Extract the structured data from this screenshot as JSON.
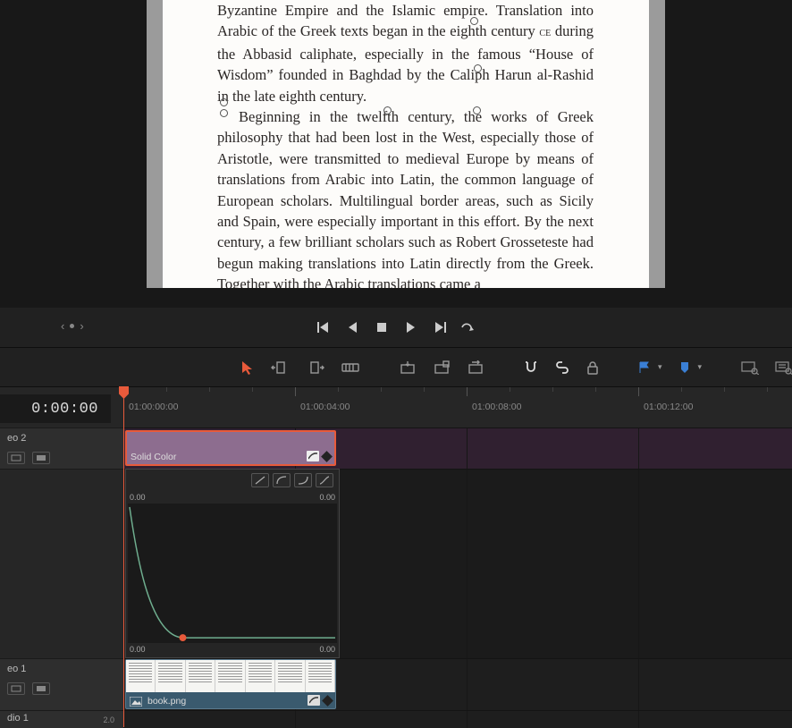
{
  "viewer": {
    "para1": "Byzantine Empire and the Islamic empire. Translation into Arabic of the Greek texts began in the eighth century ",
    "para1_ce": "ce",
    "para1b": " during the Abbasid caliphate, especially in the famous “House of Wisdom” founded in Baghdad by the Caliph Harun al-Rashid in the late eighth century.",
    "para2": "Beginning in the twelfth century, the works of Greek philosophy that had been lost in the West, especially those of Aristotle, were transmitted to medieval Europe by means of translations from Arabic into Latin, the common language of European scholars. Multilingual border areas, such as Sicily and Spain, were especially important in this effort. By the next century, a few brilliant scholars such as Robert Grosseteste had begun making translations into Latin directly from the Greek. Together with the Arabic translations came a"
  },
  "ruler": {
    "current": "0:00:00",
    "ticks": [
      "01:00:00:00",
      "01:00:04:00",
      "01:00:08:00",
      "01:00:12:00"
    ]
  },
  "tracks": {
    "video2": "eo 2",
    "video1": "eo 1",
    "audio1": "dio 1",
    "audio1_vol": "2.0"
  },
  "clips": {
    "solid_label": "Solid Color",
    "book_label": "book.png"
  },
  "curve": {
    "tl": "0.00",
    "tr": "0.00",
    "bl": "0.00",
    "br": "0.00"
  }
}
